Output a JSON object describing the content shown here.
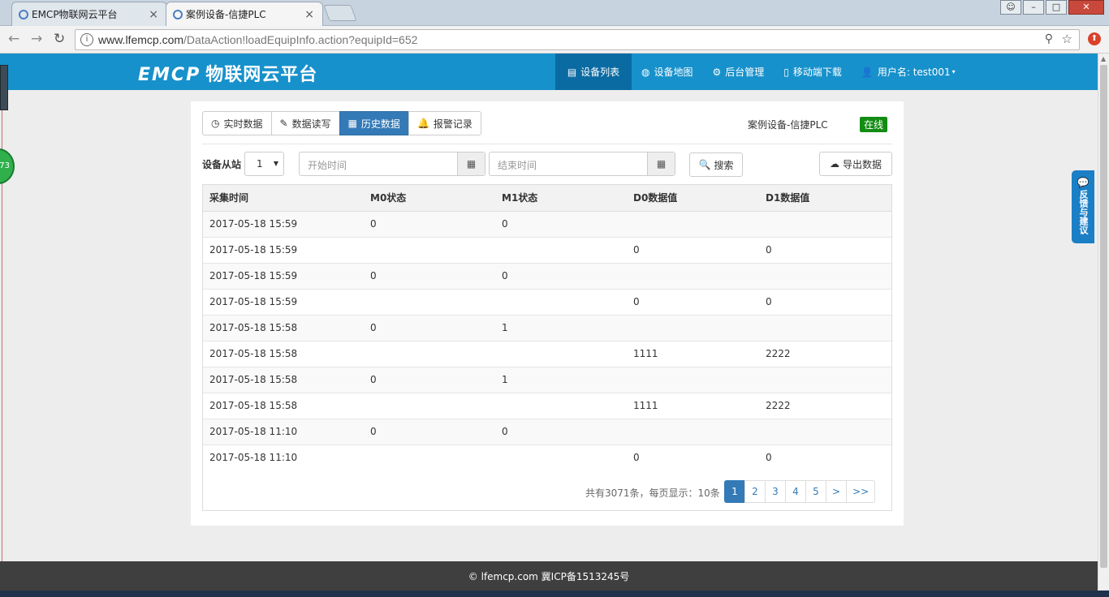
{
  "browser": {
    "tabs": [
      {
        "label": "EMCP物联网云平台"
      },
      {
        "label": "案例设备-信捷PLC"
      }
    ],
    "url_host": "www.lfemcp.com",
    "url_path": "/DataAction!loadEquipInfo.action?equipId=652"
  },
  "site": {
    "logo_mark": "EMCP",
    "logo_text": "物联网云平台",
    "nav": [
      {
        "label": "设备列表",
        "icon": "list-icon"
      },
      {
        "label": "设备地图",
        "icon": "globe-icon"
      },
      {
        "label": "后台管理",
        "icon": "gears-icon"
      },
      {
        "label": "移动端下载",
        "icon": "mobile-icon"
      },
      {
        "label": "用户名: test001",
        "icon": "user-icon"
      }
    ]
  },
  "side_widget": {
    "badge": "73"
  },
  "feedback": {
    "label": "反馈与建议"
  },
  "panel": {
    "tabs": [
      {
        "label": "实时数据",
        "icon": "clock-icon"
      },
      {
        "label": "数据读写",
        "icon": "pencil-icon"
      },
      {
        "label": "历史数据",
        "icon": "table-icon"
      },
      {
        "label": "报警记录",
        "icon": "bell-icon"
      }
    ],
    "device_name": "案例设备-信捷PLC",
    "status": "在线",
    "status_color": "#138c13",
    "filter": {
      "slave_label": "设备从站",
      "slave_value": "1",
      "start_placeholder": "开始时间",
      "end_placeholder": "结束时间",
      "search_label": "搜索",
      "export_label": "导出数据"
    },
    "table": {
      "headers": [
        "采集时间",
        "M0状态",
        "M1状态",
        "D0数据值",
        "D1数据值"
      ],
      "rows": [
        [
          "2017-05-18 15:59",
          "0",
          "0",
          "",
          ""
        ],
        [
          "2017-05-18 15:59",
          "",
          "",
          "0",
          "0"
        ],
        [
          "2017-05-18 15:59",
          "0",
          "0",
          "",
          ""
        ],
        [
          "2017-05-18 15:59",
          "",
          "",
          "0",
          "0"
        ],
        [
          "2017-05-18 15:58",
          "0",
          "1",
          "",
          ""
        ],
        [
          "2017-05-18 15:58",
          "",
          "",
          "1111",
          "2222"
        ],
        [
          "2017-05-18 15:58",
          "0",
          "1",
          "",
          ""
        ],
        [
          "2017-05-18 15:58",
          "",
          "",
          "1111",
          "2222"
        ],
        [
          "2017-05-18 11:10",
          "0",
          "0",
          "",
          ""
        ],
        [
          "2017-05-18 11:10",
          "",
          "",
          "0",
          "0"
        ]
      ]
    },
    "pagination": {
      "summary": "共有3071条，每页显示：10条",
      "pages": [
        "1",
        "2",
        "3",
        "4",
        "5",
        ">",
        ">>"
      ],
      "active": "1"
    }
  },
  "footer": {
    "text": "lfemcp.com 冀ICP备1513245号"
  }
}
